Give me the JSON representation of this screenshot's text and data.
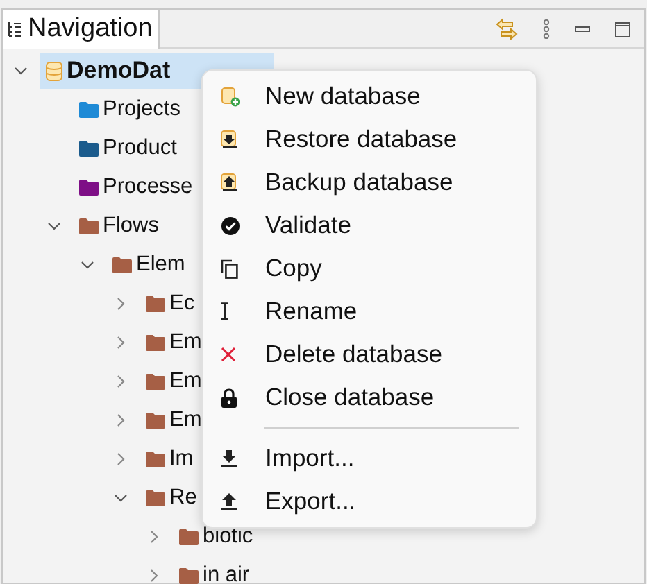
{
  "view": {
    "tab": {
      "label": "Navigation",
      "selected": true
    }
  },
  "tree": [
    {
      "label": "DemoDat",
      "kind": "database",
      "expanded": true,
      "selected": true,
      "children": [
        {
          "label": "Projects",
          "kind": "folder",
          "color": "#1e8ad6"
        },
        {
          "label": "Product",
          "kind": "folder",
          "color": "#1b5b8c"
        },
        {
          "label": "Processe",
          "kind": "folder",
          "color": "#7e0f86"
        },
        {
          "label": "Flows",
          "kind": "folder",
          "color": "#a65f45",
          "expanded": true,
          "children": [
            {
              "label": "Elem",
              "kind": "folder",
              "color": "#a65f45",
              "expanded": true,
              "children": [
                {
                  "label": "Ec",
                  "kind": "folder",
                  "color": "#a65f45",
                  "expanded": false
                },
                {
                  "label": "Em",
                  "kind": "folder",
                  "color": "#a65f45",
                  "expanded": false
                },
                {
                  "label": "Em",
                  "kind": "folder",
                  "color": "#a65f45",
                  "expanded": false
                },
                {
                  "label": "Em",
                  "kind": "folder",
                  "color": "#a65f45",
                  "expanded": false
                },
                {
                  "label": "Im",
                  "kind": "folder",
                  "color": "#a65f45",
                  "expanded": false
                },
                {
                  "label": "Re",
                  "kind": "folder",
                  "color": "#a65f45",
                  "expanded": true,
                  "children": [
                    {
                      "label": "biotic",
                      "kind": "folder",
                      "color": "#a65f45",
                      "expanded": false
                    },
                    {
                      "label": "in air",
                      "kind": "folder",
                      "color": "#a65f45",
                      "expanded": false
                    }
                  ]
                }
              ]
            }
          ]
        }
      ]
    }
  ],
  "context_menu": {
    "groups": [
      [
        "New database",
        "Restore database",
        "Backup database",
        "Validate",
        "Copy",
        "Rename",
        "Delete database",
        "Close database"
      ],
      [
        "Import...",
        "Export..."
      ]
    ]
  }
}
